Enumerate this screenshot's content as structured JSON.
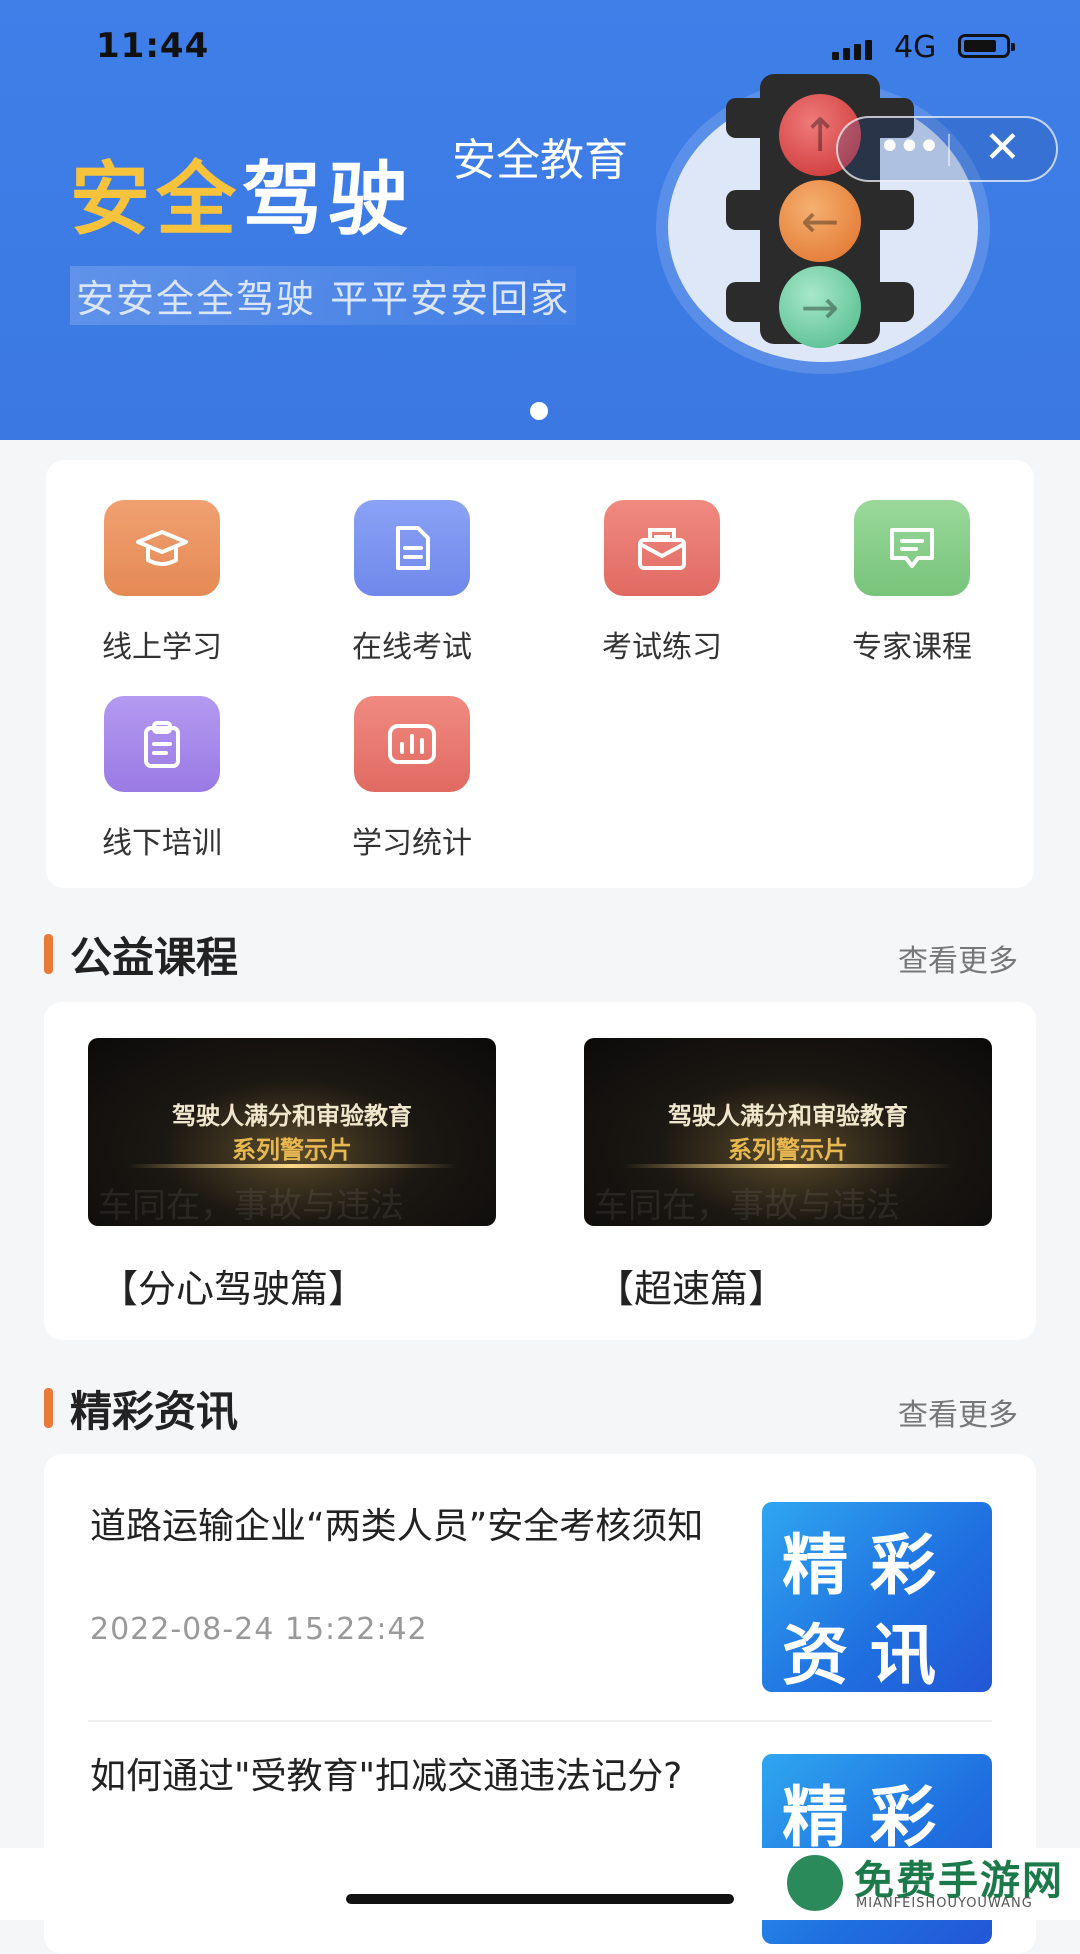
{
  "status_bar": {
    "time": "11:44",
    "network": "4G"
  },
  "banner": {
    "title_part1": "安全",
    "title_part2": "驾驶",
    "subtitle": "安全教育",
    "slogan": "安安全全驾驶  平平安安回家",
    "more_label": "•••",
    "close_label": "✕"
  },
  "menu": [
    {
      "label": "线上学习",
      "icon": "graduation-cap-icon",
      "color_top": "#f0a070",
      "color_bottom": "#e48a55"
    },
    {
      "label": "在线考试",
      "icon": "document-icon",
      "color_top": "#8aa2f5",
      "color_bottom": "#6f88ea"
    },
    {
      "label": "考试练习",
      "icon": "mail-icon",
      "color_top": "#f08a80",
      "color_bottom": "#e06a62"
    },
    {
      "label": "专家课程",
      "icon": "chat-icon",
      "color_top": "#9ad89a",
      "color_bottom": "#77c47a"
    },
    {
      "label": "线下培训",
      "icon": "clipboard-icon",
      "color_top": "#b49af0",
      "color_bottom": "#9a7ae4"
    },
    {
      "label": "学习统计",
      "icon": "bar-chart-icon",
      "color_top": "#f08a80",
      "color_bottom": "#e06a62"
    }
  ],
  "courses": {
    "title": "公益课程",
    "more": "查看更多",
    "items": [
      {
        "thumb_line1": "驾驶人满分和审验教育",
        "thumb_line2": "系列警示片",
        "title": "【分心驾驶篇】"
      },
      {
        "thumb_line1": "驾驶人满分和审验教育",
        "thumb_line2": "系列警示片",
        "title": "【超速篇】"
      }
    ]
  },
  "news": {
    "title": "精彩资讯",
    "more": "查看更多",
    "items": [
      {
        "title": "道路运输企业“两类人员”安全考核须知",
        "date": "2022-08-24 15:22:42",
        "img_row1": "精彩",
        "img_row2": "资讯"
      },
      {
        "title": "如何通过\"受教育\"扣减交通违法记分?",
        "img_row1": "精彩"
      }
    ]
  },
  "watermark": {
    "title": "免费手游网",
    "subtitle": "MIANFEISHOUYOUWANG"
  }
}
